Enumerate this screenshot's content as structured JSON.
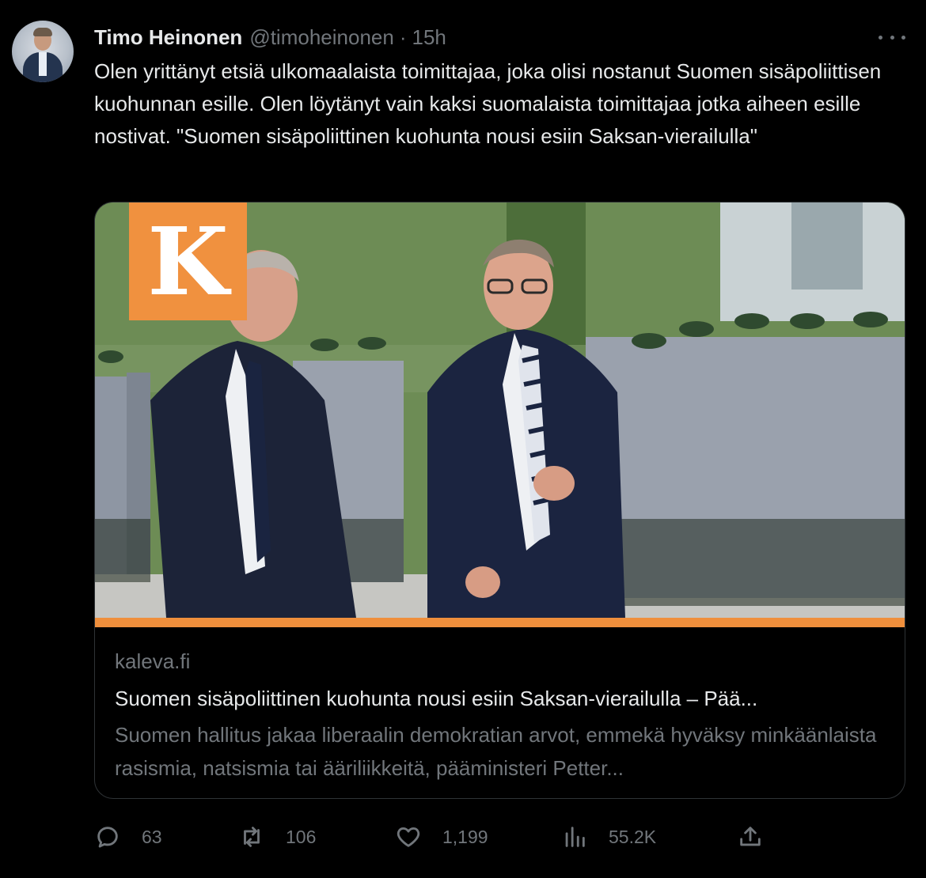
{
  "author": {
    "name": "Timo Heinonen",
    "handle": "@timoheinonen",
    "separator": "·",
    "time": "15h"
  },
  "tweet": {
    "text": "Olen yrittänyt etsiä ulkomaalaista toimittajaa, joka olisi nostanut Suomen sisäpoliittisen kuohunnan esille. Olen löytänyt vain kaksi suomalaista toimittajaa jotka aiheen esille nostivat. \"Suomen sisäpoliittinen kuohunta nousi esiin Saksan-vierailulla\""
  },
  "card": {
    "logo_letter": "K",
    "logo_color": "#f0913f",
    "accent_bar_color": "#ef8f3c",
    "domain": "kaleva.fi",
    "title": "Suomen sisäpoliittinen kuohunta nousi esiin Saksan-vierailulla – Pää...",
    "description": "Suomen hallitus jakaa liberaalin demokratian arvot, emmekä hyväksy minkäänlaista rasismia, natsismia tai ääriliikkeitä, pääministeri Petter..."
  },
  "actions": {
    "reply": {
      "icon": "reply-icon",
      "count": "63"
    },
    "repost": {
      "icon": "repost-icon",
      "count": "106"
    },
    "like": {
      "icon": "heart-icon",
      "count": "1,199"
    },
    "views": {
      "icon": "views-icon",
      "count": "55.2K"
    },
    "share": {
      "icon": "share-icon"
    }
  },
  "colors": {
    "background": "#000000",
    "text_primary": "#e7e9ea",
    "text_secondary": "#71767b",
    "border": "#2f3336"
  }
}
